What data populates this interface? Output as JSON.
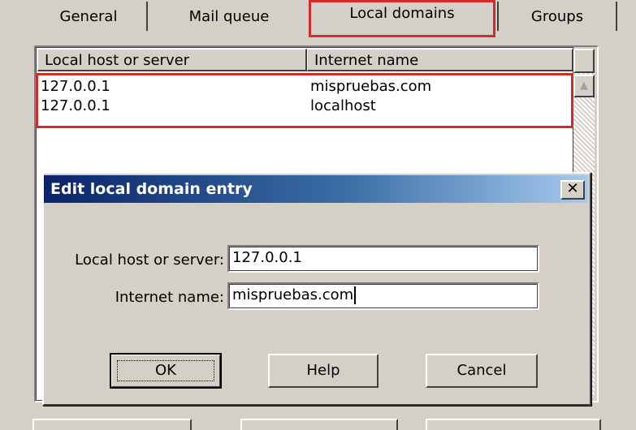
{
  "tabs": [
    {
      "label": "General"
    },
    {
      "label": "Mail queue"
    },
    {
      "label": "Local domains"
    },
    {
      "label": "Groups"
    }
  ],
  "list": {
    "columns": [
      "Local host or server",
      "Internet name"
    ],
    "rows": [
      {
        "host": "127.0.0.1",
        "name": "mispruebas.com"
      },
      {
        "host": "127.0.0.1",
        "name": "localhost"
      }
    ]
  },
  "dialog": {
    "title": "Edit local domain entry",
    "close_glyph": "✕",
    "fields": {
      "host_label": "Local host or server:",
      "host_value": "127.0.0.1",
      "name_label": "Internet name:",
      "name_value": "mispruebas.com"
    },
    "buttons": {
      "ok": "OK",
      "help": "Help",
      "cancel": "Cancel"
    }
  },
  "colors": {
    "highlight": "#d42a2a",
    "titlebar_start": "#0a246a",
    "titlebar_end": "#a6caf0"
  }
}
